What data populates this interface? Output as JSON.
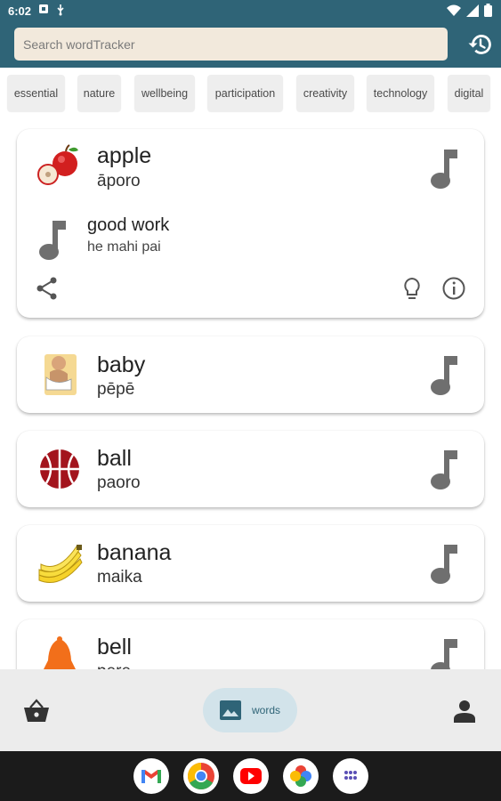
{
  "status": {
    "time": "6:02"
  },
  "search": {
    "placeholder": "Search wordTracker"
  },
  "chips": [
    "essential",
    "nature",
    "wellbeing",
    "participation",
    "creativity",
    "technology",
    "digital"
  ],
  "expanded_card": {
    "word": "apple",
    "translation": "āporo",
    "phrase": "good work",
    "phrase_translation": "he mahi pai"
  },
  "words": [
    {
      "word": "baby",
      "translation": "pēpē",
      "icon": "baby-image"
    },
    {
      "word": "ball",
      "translation": "paoro",
      "icon": "ball-image"
    },
    {
      "word": "banana",
      "translation": "maika",
      "icon": "banana-image"
    },
    {
      "word": "bell",
      "translation": "pere",
      "icon": "bell-image"
    }
  ],
  "nav": {
    "active_label": "words"
  },
  "colors": {
    "primary": "#2f6477",
    "search_bg": "#f2e9dc",
    "chip_bg": "#eeeeee",
    "note_gray": "#6f6f6f"
  }
}
